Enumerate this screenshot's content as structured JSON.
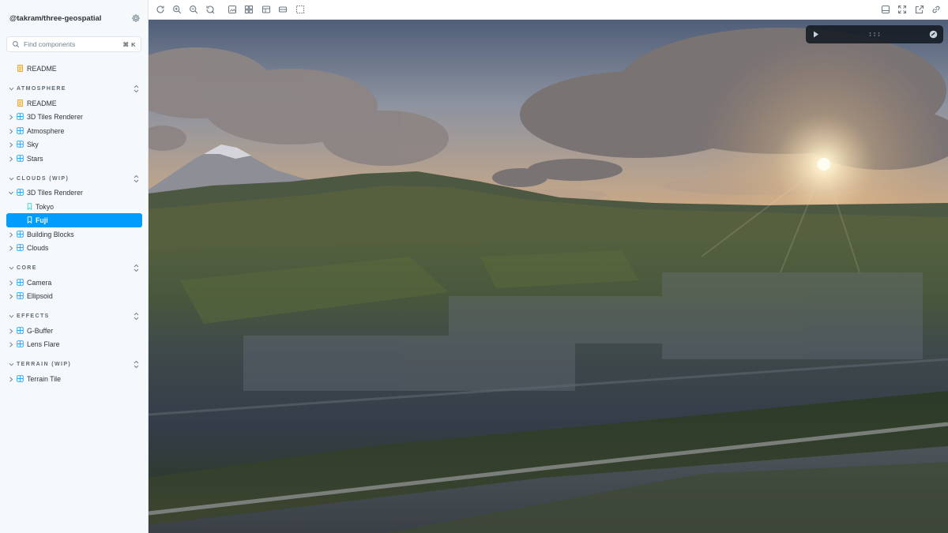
{
  "sidebar": {
    "brand": "@takram/three-geospatial",
    "search": {
      "placeholder": "Find components",
      "shortcut": "⌘ K"
    },
    "top_items": [
      {
        "label": "README",
        "icon": "document-icon"
      }
    ],
    "sections": [
      {
        "title": "ATMOSPHERE",
        "items": [
          {
            "label": "README",
            "icon": "document-icon"
          },
          {
            "label": "3D Tiles Renderer",
            "icon": "component-icon"
          },
          {
            "label": "Atmosphere",
            "icon": "component-icon"
          },
          {
            "label": "Sky",
            "icon": "component-icon"
          },
          {
            "label": "Stars",
            "icon": "component-icon"
          }
        ]
      },
      {
        "title": "CLOUDS (WIP)",
        "items": [
          {
            "label": "3D Tiles Renderer",
            "icon": "component-icon",
            "expanded": true,
            "children": [
              {
                "label": "Tokyo",
                "icon": "bookmark-icon"
              },
              {
                "label": "Fuji",
                "icon": "bookmark-icon",
                "selected": true
              }
            ]
          },
          {
            "label": "Building Blocks",
            "icon": "component-icon"
          },
          {
            "label": "Clouds",
            "icon": "component-icon"
          }
        ]
      },
      {
        "title": "CORE",
        "items": [
          {
            "label": "Camera",
            "icon": "component-icon"
          },
          {
            "label": "Ellipsoid",
            "icon": "component-icon"
          }
        ]
      },
      {
        "title": "EFFECTS",
        "items": [
          {
            "label": "G-Buffer",
            "icon": "component-icon"
          },
          {
            "label": "Lens Flare",
            "icon": "component-icon"
          }
        ]
      },
      {
        "title": "TERRAIN (WIP)",
        "items": [
          {
            "label": "Terrain Tile",
            "icon": "component-icon"
          }
        ]
      }
    ]
  },
  "toolbar": {
    "left_icons": [
      "reload-icon",
      "zoom-in-icon",
      "zoom-out-icon",
      "zoom-reset-icon",
      "background-icon",
      "grid-icon",
      "viewport-icon",
      "measure-icon",
      "outline-icon"
    ],
    "right_icons": [
      "panel-toggle-icon",
      "fullscreen-icon",
      "open-new-tab-icon",
      "copy-link-icon"
    ]
  },
  "colors": {
    "accent": "#029cfd",
    "sidebar_bg": "#f6f9fc",
    "panel_bg": "#141a22"
  }
}
